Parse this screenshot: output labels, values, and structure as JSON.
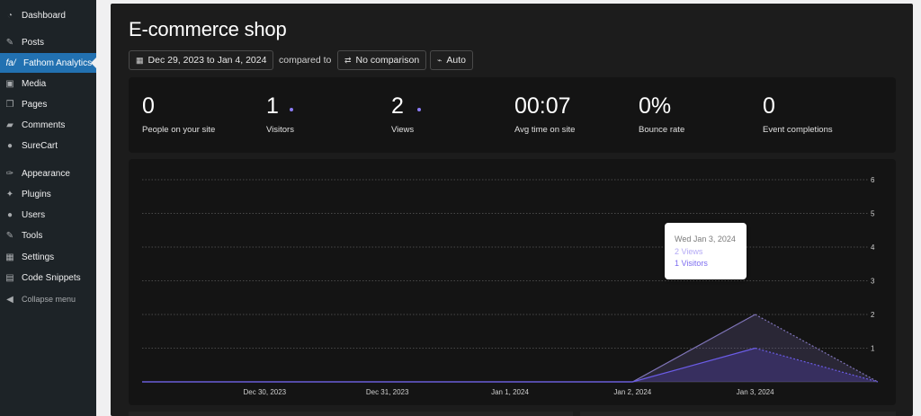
{
  "sidebar": {
    "items": [
      {
        "label": "Dashboard",
        "icon": "dashboard-icon",
        "glyph": "◔"
      },
      {
        "label": "Posts",
        "icon": "pin-icon",
        "glyph": "✎"
      },
      {
        "label": "Fathom Analytics",
        "icon": "fathom-logo-icon",
        "glyph": "fa/"
      },
      {
        "label": "Media",
        "icon": "media-icon",
        "glyph": "▣"
      },
      {
        "label": "Pages",
        "icon": "pages-icon",
        "glyph": "❐"
      },
      {
        "label": "Comments",
        "icon": "comments-icon",
        "glyph": "▰"
      },
      {
        "label": "SureCart",
        "icon": "surecart-icon",
        "glyph": "●"
      },
      {
        "label": "Appearance",
        "icon": "appearance-icon",
        "glyph": "✑"
      },
      {
        "label": "Plugins",
        "icon": "plugins-icon",
        "glyph": "✦"
      },
      {
        "label": "Users",
        "icon": "users-icon",
        "glyph": "●"
      },
      {
        "label": "Tools",
        "icon": "tools-icon",
        "glyph": "✎"
      },
      {
        "label": "Settings",
        "icon": "settings-icon",
        "glyph": "▦"
      },
      {
        "label": "Code Snippets",
        "icon": "code-snippets-icon",
        "glyph": "▤"
      },
      {
        "label": "Collapse menu",
        "icon": "collapse-icon",
        "glyph": "◀"
      }
    ],
    "active": "Fathom Analytics"
  },
  "page": {
    "title": "E-commerce shop"
  },
  "toolbar": {
    "date_range": "Dec 29, 2023 to Jan 4, 2024",
    "compared_to": "compared to",
    "comparison": "No comparison",
    "interval": "Auto"
  },
  "stats": [
    {
      "value": "0",
      "label": "People on your site",
      "dot": false
    },
    {
      "value": "1",
      "label": "Visitors",
      "dot": true
    },
    {
      "value": "2",
      "label": "Views",
      "dot": true
    },
    {
      "value": "00:07",
      "label": "Avg time on site",
      "dot": false
    },
    {
      "value": "0%",
      "label": "Bounce rate",
      "dot": false
    },
    {
      "value": "0",
      "label": "Event completions",
      "dot": false
    }
  ],
  "colors": {
    "views": "#7a6fb0",
    "visitors": "#6b5ce7",
    "accent": "#8b7cf6",
    "wp_active": "#2271b1"
  },
  "chart_data": {
    "type": "area",
    "x": [
      "Dec 29, 2023",
      "Dec 30, 2023",
      "Dec 31, 2023",
      "Jan 1, 2024",
      "Jan 2, 2024",
      "Jan 3, 2024",
      "Jan 4, 2024"
    ],
    "x_tick_labels": [
      "Dec 30, 2023",
      "Dec 31, 2023",
      "Jan 1, 2024",
      "Jan 2, 2024",
      "Jan 3, 2024"
    ],
    "series": [
      {
        "name": "Views",
        "values": [
          0,
          0,
          0,
          0,
          0,
          2,
          0
        ]
      },
      {
        "name": "Visitors",
        "values": [
          0,
          0,
          0,
          0,
          0,
          1,
          0
        ]
      }
    ],
    "ylim": [
      0,
      6
    ],
    "y_ticks": [
      1,
      2,
      3,
      4,
      5,
      6
    ],
    "grid": true,
    "dashed_last_segment": true
  },
  "tooltip": {
    "date": "Wed Jan 3, 2024",
    "views": "2 Views",
    "visitors": "1 Visitors"
  }
}
